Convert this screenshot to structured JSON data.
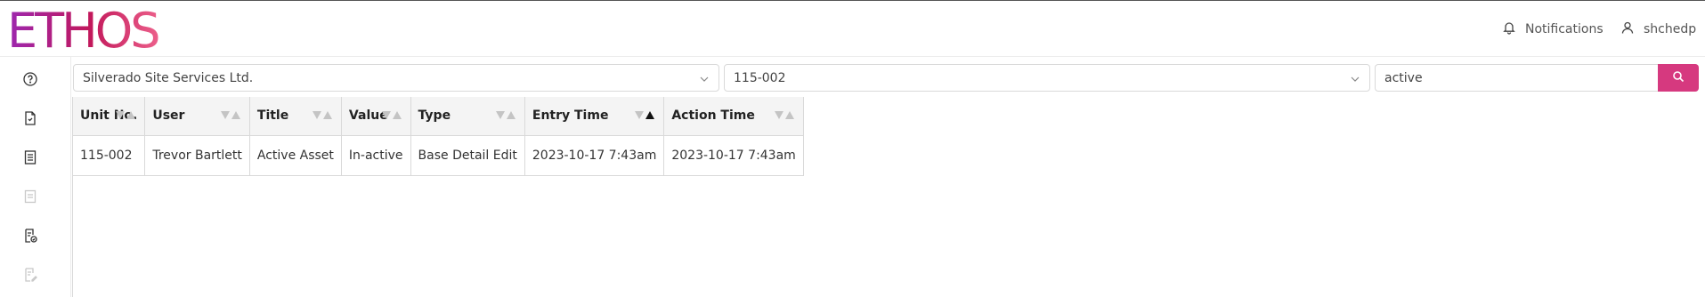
{
  "app": {
    "logo": "ETHOS",
    "brand_color": "#d6397f"
  },
  "header": {
    "notifications_label": "Notifications",
    "user_label": "shchedp"
  },
  "sidebar": {
    "items": [
      {
        "name": "help-circle-icon",
        "enabled": true
      },
      {
        "name": "document-icon",
        "enabled": true
      },
      {
        "name": "report-icon",
        "enabled": true
      },
      {
        "name": "receipt-icon",
        "enabled": false
      },
      {
        "name": "document-check-icon",
        "enabled": true
      },
      {
        "name": "document-edit-icon",
        "enabled": false
      }
    ]
  },
  "filters": {
    "company": "Silverado Site Services Ltd.",
    "unit": "115-002",
    "search_value": "active"
  },
  "table": {
    "columns": [
      "Unit No.",
      "User",
      "Title",
      "Value",
      "Type",
      "Entry Time",
      "Action Time"
    ],
    "sorted_column": "Entry Time",
    "sort_direction": "ascending",
    "rows": [
      [
        "115-002",
        "Trevor Bartlett",
        "Active Asset",
        "In-active",
        "Base Detail Edit",
        "2023-10-17 7:43am",
        "2023-10-17 7:43am"
      ]
    ]
  }
}
